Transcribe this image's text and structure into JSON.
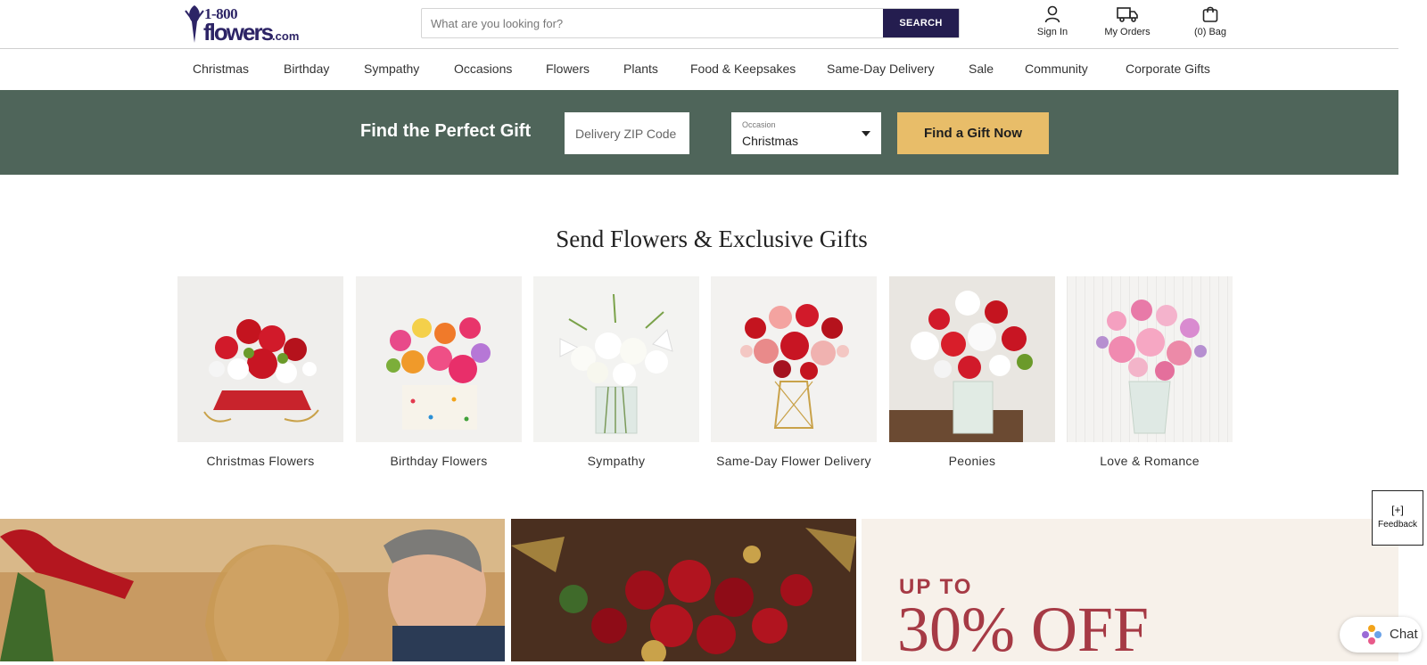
{
  "header": {
    "logo": {
      "number": "1-800",
      "word": "flowers",
      "suffix": ".com"
    },
    "search": {
      "placeholder": "What are you looking for?",
      "button_label": "SEARCH"
    },
    "actions": [
      {
        "label": "Sign In",
        "icon": "person-icon"
      },
      {
        "label": "My Orders",
        "icon": "truck-icon"
      },
      {
        "label": "(0) Bag",
        "icon": "bag-icon"
      }
    ]
  },
  "nav": {
    "items": [
      "Christmas",
      "Birthday",
      "Sympathy",
      "Occasions",
      "Flowers",
      "Plants",
      "Food & Keepsakes",
      "Same-Day Delivery",
      "Sale",
      "Community",
      "Corporate Gifts"
    ]
  },
  "finder": {
    "title": "Find the Perfect Gift",
    "zip_placeholder": "Delivery ZIP Code",
    "occasion_label": "Occasion",
    "occasion_value": "Christmas",
    "button_label": "Find a Gift Now"
  },
  "section": {
    "title": "Send Flowers & Exclusive Gifts",
    "tiles": [
      {
        "label": "Christmas Flowers"
      },
      {
        "label": "Birthday Flowers"
      },
      {
        "label": "Sympathy"
      },
      {
        "label": "Same-Day Flower Delivery"
      },
      {
        "label": "Peonies"
      },
      {
        "label": "Love & Romance"
      }
    ]
  },
  "promo": {
    "line1": "UP TO",
    "line2": "30% OFF"
  },
  "feedback": {
    "icon": "[+]",
    "label": "Feedback"
  },
  "chat": {
    "label": "Chat"
  },
  "colors": {
    "brand_navy": "#241d4f",
    "finder_green": "#4f655a",
    "cta_gold": "#e8bd69",
    "promo_red": "#a63a45"
  }
}
